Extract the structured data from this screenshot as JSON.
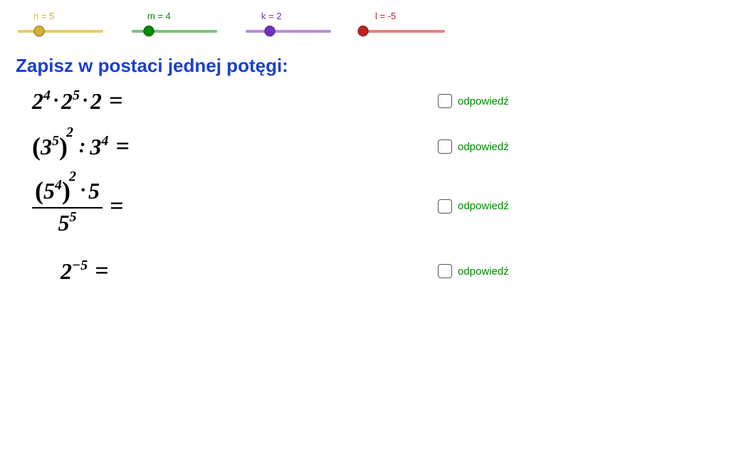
{
  "sliders": {
    "n": {
      "label": "n = 5",
      "color": "#d4b030",
      "lineColor": "#e8cc60",
      "thumbPos": "25%"
    },
    "m": {
      "label": "m = 4",
      "color": "#008800",
      "lineColor": "#7ac47a",
      "thumbPos": "20%"
    },
    "k": {
      "label": "k = 2",
      "color": "#7030c0",
      "lineColor": "#b590d8",
      "thumbPos": "28%"
    },
    "l": {
      "label": "l = -5",
      "color": "#c02020",
      "lineColor": "#e88080",
      "thumbPos": "4%"
    }
  },
  "title": "Zapisz w postaci jednej potęgi:",
  "equations": {
    "eq1": {
      "b1": "2",
      "e1": "4",
      "b2": "2",
      "e2": "5",
      "b3": "2",
      "eq": "="
    },
    "eq2": {
      "ib": "3",
      "ie": "5",
      "oe": "2",
      "op": ":",
      "rb": "3",
      "re": "4",
      "eq": "="
    },
    "eq3": {
      "nib": "5",
      "nie": "4",
      "noe": "2",
      "ntail": "5",
      "db": "5",
      "de": "5",
      "eq": "="
    },
    "eq4": {
      "b": "2",
      "e": "−5",
      "eq": "="
    }
  },
  "answerLabel": "odpowiedź"
}
